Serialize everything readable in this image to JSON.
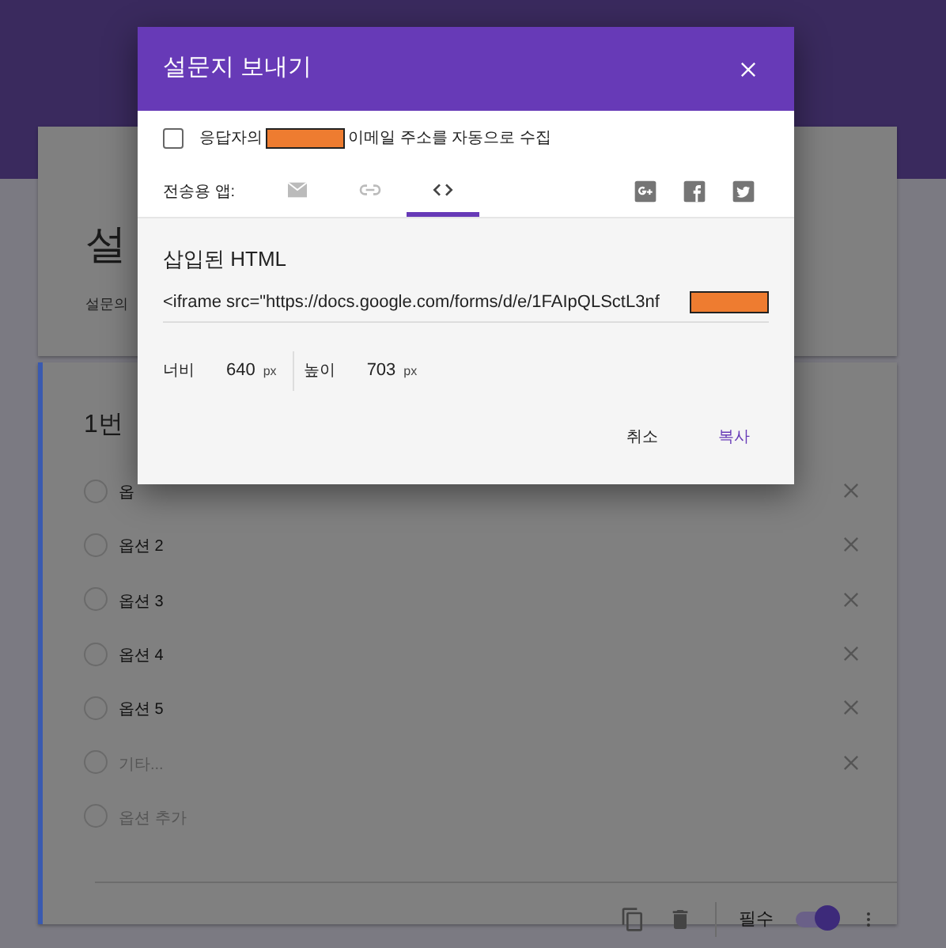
{
  "form": {
    "title": "설",
    "description": "설문의",
    "question": {
      "title": "1번",
      "options": [
        {
          "label": "옵",
          "kind": "option",
          "selected": false
        },
        {
          "label": "옵션 2",
          "kind": "option",
          "selected": false
        },
        {
          "label": "옵션 3",
          "kind": "option",
          "selected": false
        },
        {
          "label": "옵션 4",
          "kind": "option",
          "selected": false
        },
        {
          "label": "옵션 5",
          "kind": "option",
          "selected": false
        },
        {
          "label": "기타...",
          "kind": "other",
          "selected": false
        },
        {
          "label": "옵션 추가",
          "kind": "add",
          "selected": false
        }
      ],
      "required_label": "필수",
      "required": true
    }
  },
  "dialog": {
    "title": "설문지 보내기",
    "collect_email": {
      "label_before": "응답자의",
      "label_after": "이메일 주소를 자동으로 수집",
      "checked": false
    },
    "send_via_label": "전송용 앱:",
    "send_tabs": [
      {
        "kind": "email",
        "selected": false
      },
      {
        "kind": "link",
        "selected": false
      },
      {
        "kind": "embed",
        "selected": true
      }
    ],
    "share_icons": [
      {
        "kind": "google-plus"
      },
      {
        "kind": "facebook"
      },
      {
        "kind": "twitter"
      }
    ],
    "section_title": "삽입된 HTML",
    "embed_code": "<iframe src=\"https://docs.google.com/forms/d/e/1FAIpQLSctL3nf",
    "width": {
      "label": "너비",
      "value": "640",
      "unit": "px"
    },
    "height": {
      "label": "높이",
      "value": "703",
      "unit": "px"
    },
    "buttons": [
      {
        "label": "취소",
        "kind": "cancel"
      },
      {
        "label": "복사",
        "kind": "copy"
      }
    ]
  }
}
